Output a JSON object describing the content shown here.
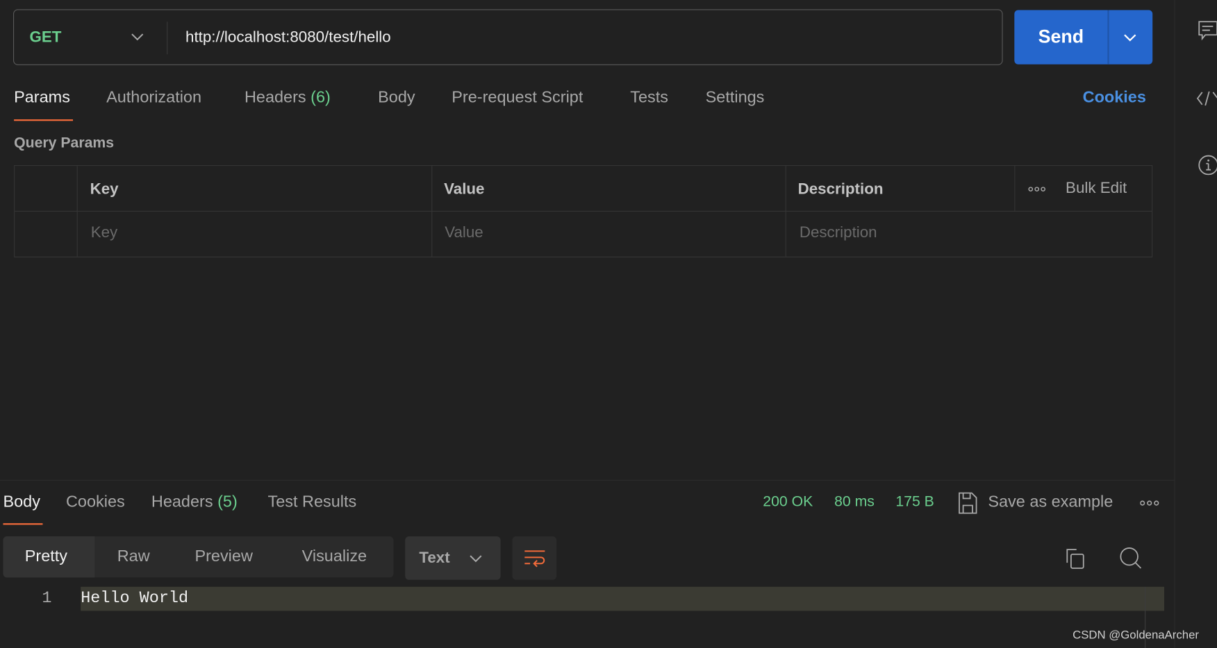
{
  "request": {
    "method": "GET",
    "url": "http://localhost:8080/test/hello",
    "send_label": "Send"
  },
  "request_tabs": [
    {
      "label": "Params"
    },
    {
      "label": "Authorization"
    },
    {
      "label": "Headers",
      "count": "(6)"
    },
    {
      "label": "Body"
    },
    {
      "label": "Pre-request Script"
    },
    {
      "label": "Tests"
    },
    {
      "label": "Settings"
    }
  ],
  "cookies_link": "Cookies",
  "query_params": {
    "title": "Query Params",
    "columns": [
      "Key",
      "Value",
      "Description"
    ],
    "bulk_edit": "Bulk Edit",
    "placeholders": {
      "key": "Key",
      "value": "Value",
      "description": "Description"
    }
  },
  "response": {
    "tabs": [
      {
        "label": "Body"
      },
      {
        "label": "Cookies"
      },
      {
        "label": "Headers",
        "count": "(5)"
      },
      {
        "label": "Test Results"
      }
    ],
    "status": "200 OK",
    "time": "80 ms",
    "size": "175 B",
    "save_example": "Save as example",
    "view_modes": [
      "Pretty",
      "Raw",
      "Preview",
      "Visualize"
    ],
    "format": "Text",
    "lines": [
      {
        "number": "1",
        "text": "Hello World"
      }
    ]
  },
  "watermark": "CSDN @GoldenaArcher",
  "colors": {
    "accent": "#2566cc",
    "success": "#6bcf8e",
    "active_tab": "#f26b3a",
    "link": "#4a90e2"
  }
}
